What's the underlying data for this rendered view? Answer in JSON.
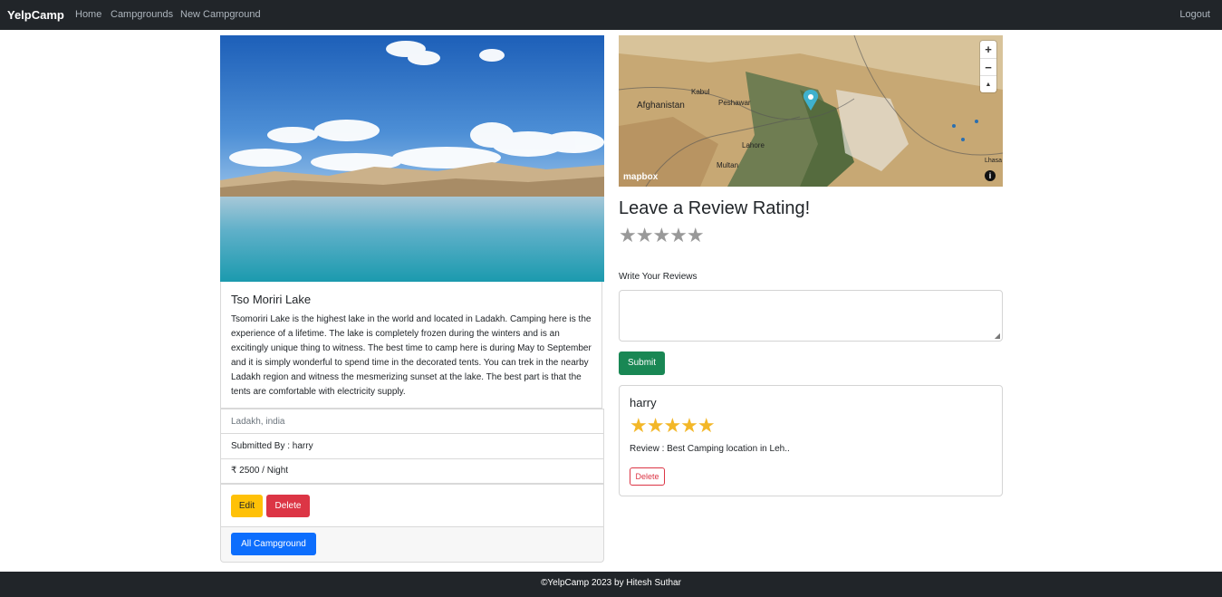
{
  "nav": {
    "brand": "YelpCamp",
    "links": [
      "Home",
      "Campgrounds",
      "New Campground"
    ],
    "logout": "Logout"
  },
  "campground": {
    "title": "Tso Moriri Lake",
    "description": "Tsomoriri Lake is the highest lake in the world and located in Ladakh. Camping here is the experience of a lifetime. The lake is completely frozen during the winters and is an excitingly unique thing to witness. The best time to camp here is during May to September and it is simply wonderful to spend time in the decorated tents. You can trek in the nearby Ladakh region and witness the mesmerizing sunset at the lake. The best part is that the tents are comfortable with electricity supply.",
    "location": "Ladakh, india",
    "submitted_by": "Submitted By : harry",
    "price": "₹ 2500 / Night",
    "edit_label": "Edit",
    "delete_label": "Delete",
    "all_label": "All Campground"
  },
  "map": {
    "zoom_in": "+",
    "zoom_out": "−",
    "compass": "▲",
    "logo": "mapbox",
    "info": "i",
    "labels": [
      "Afghanistan",
      "Peshawar",
      "Lahore",
      "Multan",
      "Kabul",
      "Lhasa"
    ]
  },
  "review_form": {
    "heading": "Leave a Review Rating!",
    "stars": "★★★★★",
    "label": "Write Your Reviews",
    "submit_label": "Submit",
    "rating_empty": 0
  },
  "reviews": [
    {
      "author": "harry",
      "stars": "★★★★★",
      "rating": 5,
      "text": "Review : Best Camping location in Leh..",
      "delete_label": "Delete"
    }
  ],
  "footer": {
    "text": "©YelpCamp 2023 by Hitesh Suthar"
  },
  "colors": {
    "navbar": "#212529",
    "edit": "#ffc107",
    "delete": "#dc3545",
    "primary": "#0d6efd",
    "submit": "#198754",
    "star": "#f3b728"
  }
}
